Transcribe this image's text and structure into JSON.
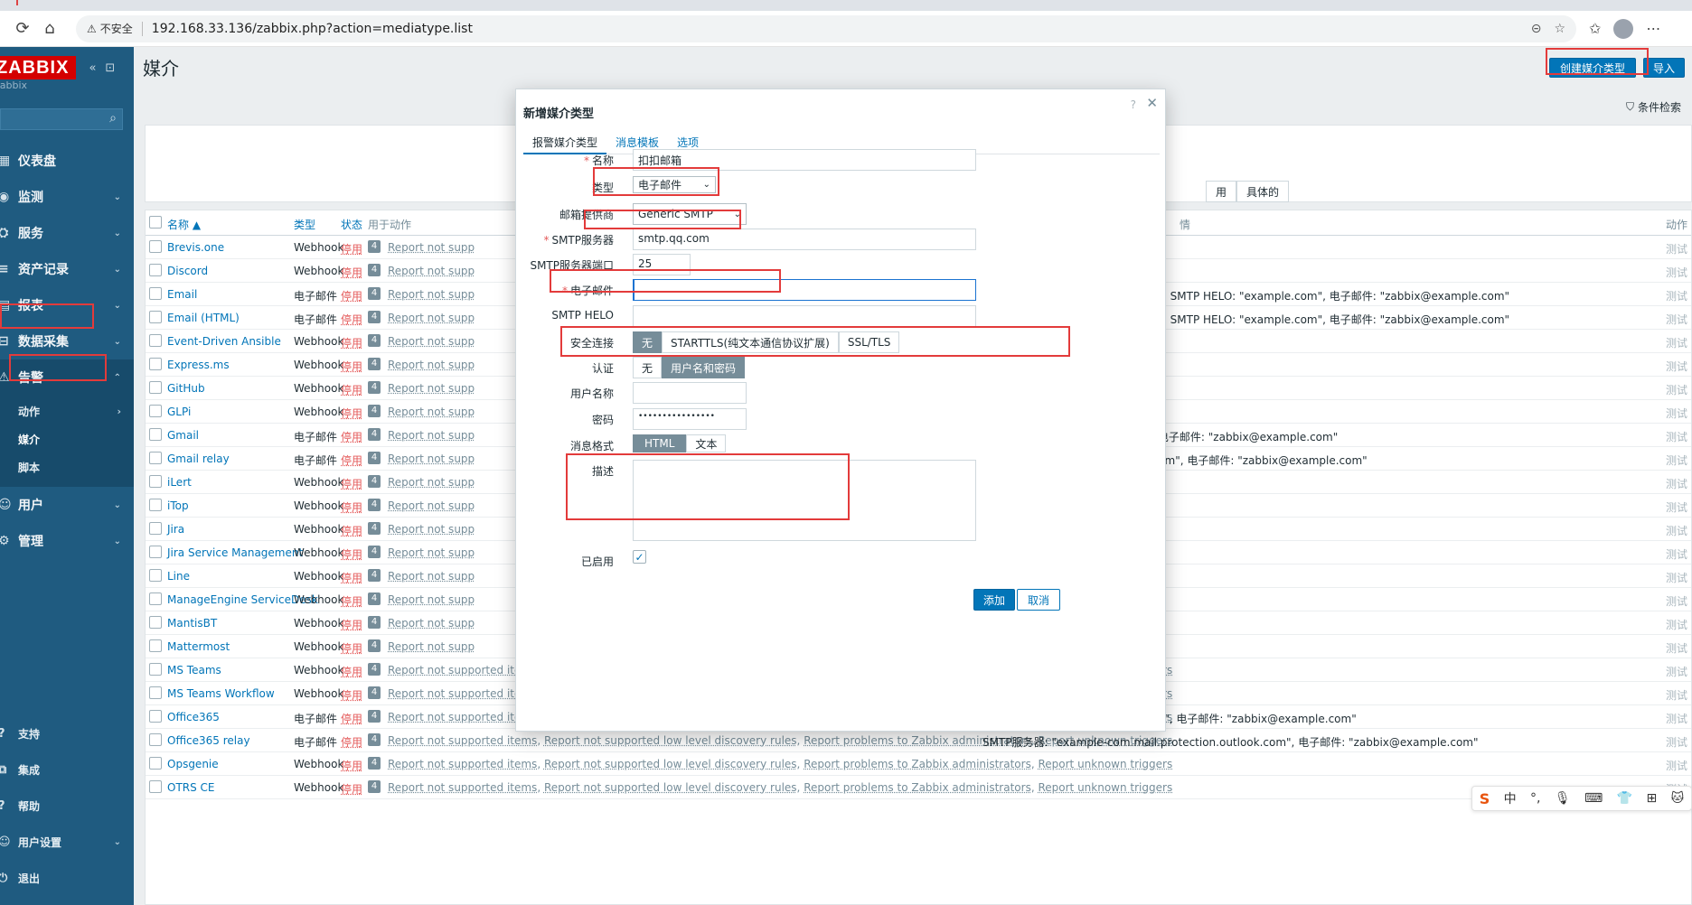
{
  "browser": {
    "security_label": "不安全",
    "url": "192.168.33.136/zabbix.php?action=mediatype.list"
  },
  "sidebar": {
    "logo": "ZABBIX",
    "server": "zabbix",
    "menu": [
      {
        "label": "仪表盘",
        "icon": "dashboard-icon"
      },
      {
        "label": "监测",
        "icon": "monitor-icon"
      },
      {
        "label": "服务",
        "icon": "services-icon"
      },
      {
        "label": "资产记录",
        "icon": "inventory-icon"
      },
      {
        "label": "报表",
        "icon": "reports-icon"
      },
      {
        "label": "数据采集",
        "icon": "data-collection-icon"
      },
      {
        "label": "告警",
        "icon": "alerts-icon"
      }
    ],
    "alerts_sub": [
      "动作",
      "媒介",
      "脚本"
    ],
    "menu_after": [
      {
        "label": "用户",
        "icon": "users-icon"
      },
      {
        "label": "管理",
        "icon": "admin-icon"
      }
    ],
    "bottom": [
      {
        "label": "支持",
        "icon": "support-icon"
      },
      {
        "label": "集成",
        "icon": "integrations-icon"
      },
      {
        "label": "帮助",
        "icon": "help-icon"
      },
      {
        "label": "用户设置",
        "icon": "user-settings-icon"
      },
      {
        "label": "退出",
        "icon": "signout-icon"
      }
    ]
  },
  "page": {
    "title": "媒介",
    "create_button": "创建媒介类型",
    "import_button": "导入",
    "filter_label": "条件检索",
    "filter_seg": [
      "用",
      "具体的"
    ]
  },
  "table": {
    "headers": {
      "name": "名称 ▲",
      "type": "类型",
      "status": "状态",
      "used": "用于动作",
      "details": "情",
      "action": "动作"
    },
    "action_full": [
      "Report not supported items",
      "Report not supported low level discovery rules",
      "Report problems to Zabbix administrators",
      "Report unknown triggers"
    ],
    "action_short": "Report not supp",
    "status_label": "停用",
    "badge": "4",
    "test_label": "测试",
    "rows": [
      {
        "name": "Brevis.one",
        "type": "Webhook",
        "details": ""
      },
      {
        "name": "Discord",
        "type": "Webhook",
        "details": ""
      },
      {
        "name": "Email",
        "type": "电子邮件",
        "details": "SMTP服务器: \"mail.example.com\", SMTP HELO: \"example.com\", 电子邮件: \"zabbix@example.com\""
      },
      {
        "name": "Email (HTML)",
        "type": "电子邮件",
        "details": "SMTP服务器: \"mail.example.com\", SMTP HELO: \"example.com\", 电子邮件: \"zabbix@example.com\""
      },
      {
        "name": "Event-Driven Ansible",
        "type": "Webhook",
        "details": ""
      },
      {
        "name": "Express.ms",
        "type": "Webhook",
        "details": ""
      },
      {
        "name": "GitHub",
        "type": "Webhook",
        "details": ""
      },
      {
        "name": "GLPi",
        "type": "Webhook",
        "details": ""
      },
      {
        "name": "Gmail",
        "type": "电子邮件",
        "details": "SMTP服务器: \"smtp.gmail.com\", 电子邮件: \"zabbix@example.com\""
      },
      {
        "name": "Gmail relay",
        "type": "电子邮件",
        "details": "SMTP服务器: \"smtp-relay.gmail.com\", 电子邮件: \"zabbix@example.com\""
      },
      {
        "name": "iLert",
        "type": "Webhook",
        "details": ""
      },
      {
        "name": "iTop",
        "type": "Webhook",
        "details": ""
      },
      {
        "name": "Jira",
        "type": "Webhook",
        "details": ""
      },
      {
        "name": "Jira Service Management",
        "type": "Webhook",
        "details": ""
      },
      {
        "name": "Line",
        "type": "Webhook",
        "details": ""
      },
      {
        "name": "ManageEngine ServiceDesk",
        "type": "Webhook",
        "details": ""
      },
      {
        "name": "MantisBT",
        "type": "Webhook",
        "details": ""
      },
      {
        "name": "Mattermost",
        "type": "Webhook",
        "details": ""
      },
      {
        "name": "MS Teams",
        "type": "Webhook",
        "details": ""
      },
      {
        "name": "MS Teams Workflow",
        "type": "Webhook",
        "details": ""
      },
      {
        "name": "Office365",
        "type": "电子邮件",
        "details": "SMTP服务器: \"smtp.office365.com\", 电子邮件: \"zabbix@example.com\""
      },
      {
        "name": "Office365 relay",
        "type": "电子邮件",
        "details": "SMTP服务器: \"example-com.mail.protection.outlook.com\", 电子邮件: \"zabbix@example.com\""
      },
      {
        "name": "Opsgenie",
        "type": "Webhook",
        "details": ""
      },
      {
        "name": "OTRS CE",
        "type": "Webhook",
        "details": ""
      }
    ]
  },
  "modal": {
    "title": "新增媒介类型",
    "help": "?",
    "tabs": [
      "报警媒介类型",
      "消息模板",
      "选项"
    ],
    "fields": {
      "name_label": "名称",
      "name_value": "扣扣邮箱",
      "type_label": "类型",
      "type_value": "电子邮件",
      "provider_label": "邮箱提供商",
      "provider_value": "Generic SMTP",
      "smtp_server_label": "SMTP服务器",
      "smtp_server_value": "smtp.qq.com",
      "smtp_port_label": "SMTP服务器端口",
      "smtp_port_value": "25",
      "email_label": "电子邮件",
      "email_value": "",
      "helo_label": "SMTP HELO",
      "helo_value": "",
      "security_label": "安全连接",
      "security_options": [
        "无",
        "STARTTLS(纯文本通信协议扩展)",
        "SSL/TLS"
      ],
      "auth_label": "认证",
      "auth_options": [
        "无",
        "用户名和密码"
      ],
      "username_label": "用户名称",
      "username_value": "",
      "password_label": "密码",
      "password_value": "••••••••••••••••",
      "format_label": "消息格式",
      "format_options": [
        "HTML",
        "文本"
      ],
      "desc_label": "描述",
      "enabled_label": "已启用"
    },
    "add_button": "添加",
    "cancel_button": "取消"
  },
  "ime": {
    "items": [
      "S",
      "中",
      "°,",
      "🎙",
      "⌨",
      "👕",
      "⊞",
      "🐱"
    ]
  }
}
